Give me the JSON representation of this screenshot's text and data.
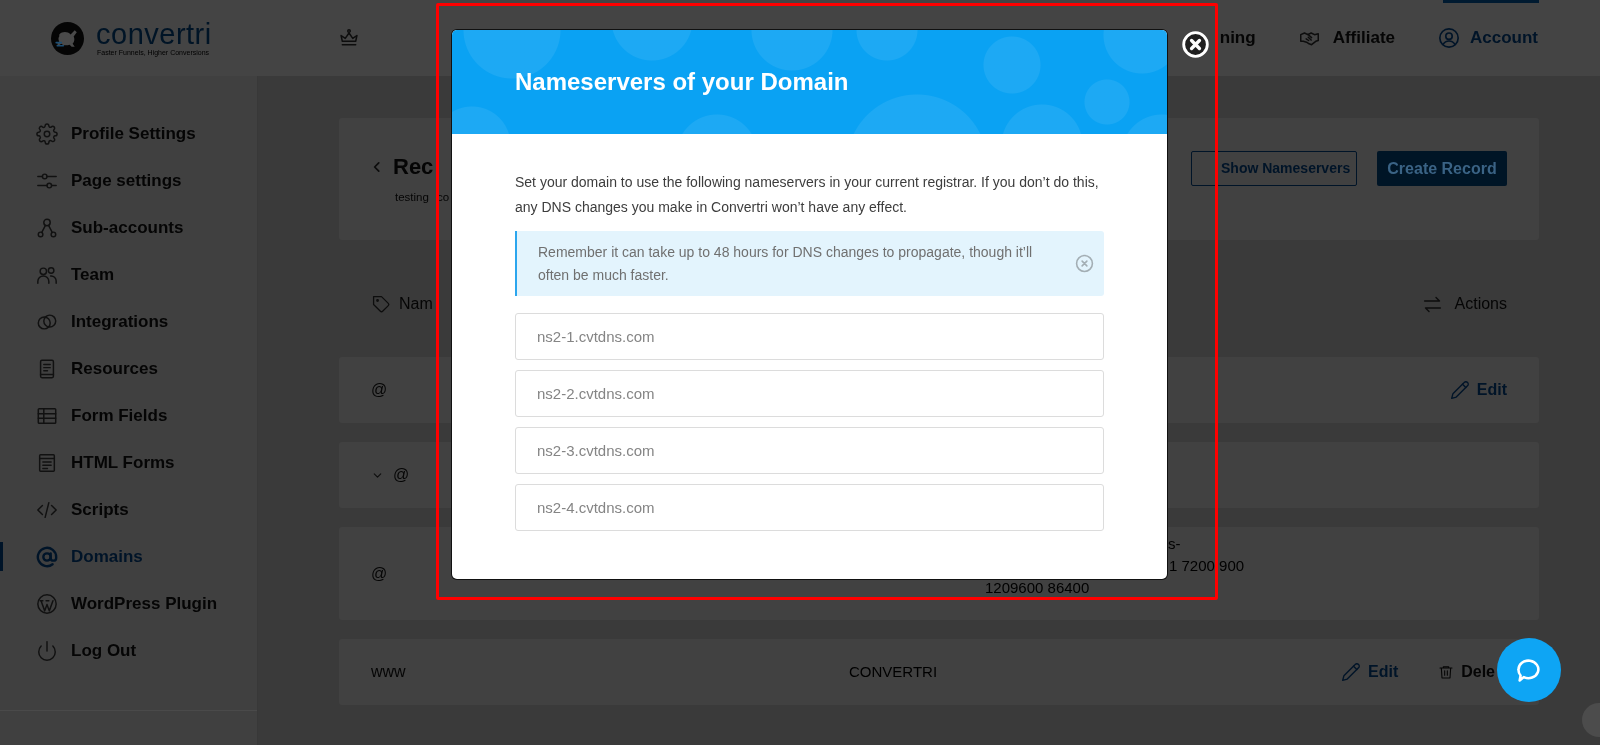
{
  "header": {
    "brand": {
      "name": "convertri",
      "tagline": "Faster Funnels, Higher Conversions"
    },
    "nav": [
      {
        "label": "ning",
        "selected": false
      },
      {
        "label": "Affiliate",
        "selected": false
      },
      {
        "label": "Account",
        "selected": true
      }
    ]
  },
  "sidebar": {
    "items": [
      {
        "label": "Profile Settings",
        "selected": false
      },
      {
        "label": "Page settings",
        "selected": false
      },
      {
        "label": "Sub-accounts",
        "selected": false
      },
      {
        "label": "Team",
        "selected": false
      },
      {
        "label": "Integrations",
        "selected": false
      },
      {
        "label": "Resources",
        "selected": false
      },
      {
        "label": "Form Fields",
        "selected": false
      },
      {
        "label": "HTML Forms",
        "selected": false
      },
      {
        "label": "Scripts",
        "selected": false
      },
      {
        "label": "Domains",
        "selected": true
      },
      {
        "label": "WordPress Plugin",
        "selected": false
      },
      {
        "label": "Log Out",
        "selected": false
      }
    ]
  },
  "records": {
    "title": "Rec",
    "subtitle": "testing co",
    "buttons": [
      {
        "label": "Show Nameservers",
        "kind": "outline"
      },
      {
        "label": "Create Record",
        "kind": "primary"
      }
    ]
  },
  "table": {
    "columns": [
      "Nam",
      "Actions"
    ],
    "rows": [
      {
        "name": "@",
        "expandable": false,
        "actions": [
          {
            "kind": "edit",
            "label": "Edit"
          }
        ]
      },
      {
        "name": "@",
        "expandable": true
      },
      {
        "name": "@",
        "expandable": false,
        "value": [
          "s-",
          "1 7200 900",
          "1209600 86400"
        ]
      },
      {
        "name": "www",
        "expandable": false,
        "value": [
          "CONVERTRI"
        ],
        "actions": [
          {
            "kind": "edit",
            "label": "Edit"
          },
          {
            "kind": "delete",
            "label": "Dele"
          }
        ]
      }
    ]
  },
  "modal": {
    "title": "Nameservers of your Domain",
    "description": "Set your domain to use the following nameservers in your current registrar. If you don’t do this, any DNS changes you make in Convertri won’t have any effect.",
    "notice": "Remember it can take up to 48 hours for DNS changes to propagate, though it’ll often be much faster.",
    "nameservers": [
      {
        "value": "ns2-1.cvtdns.com"
      },
      {
        "value": "ns2-2.cvtdns.com"
      },
      {
        "value": "ns2-3.cvtdns.com"
      },
      {
        "value": "ns2-4.cvtdns.com"
      }
    ]
  }
}
